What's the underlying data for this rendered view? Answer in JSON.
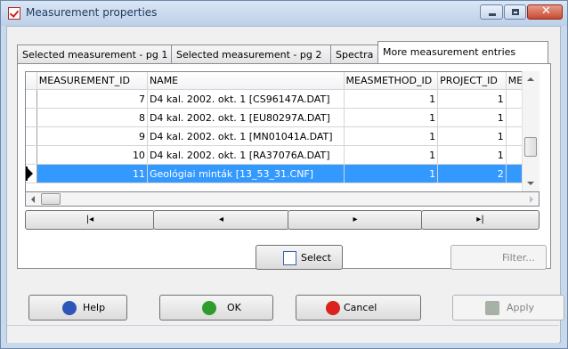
{
  "window": {
    "title": "Measurement properties"
  },
  "tabs": [
    "Selected measurement - pg 1",
    "Selected measurement - pg 2",
    "Spectra",
    "More measurement entries"
  ],
  "table": {
    "columns": [
      "MEASUREMENT_ID",
      "NAME",
      "MEASMETHOD_ID",
      "PROJECT_ID",
      "ME/"
    ],
    "rows": [
      {
        "id": "7",
        "name": "D4 kal. 2002. okt. 1 [CS96147A.DAT]",
        "method": "1",
        "project": "1"
      },
      {
        "id": "8",
        "name": "D4 kal. 2002. okt. 1 [EU80297A.DAT]",
        "method": "1",
        "project": "1"
      },
      {
        "id": "9",
        "name": "D4 kal. 2002. okt. 1 [MN01041A.DAT]",
        "method": "1",
        "project": "1"
      },
      {
        "id": "10",
        "name": "D4 kal. 2002. okt. 1 [RA37076A.DAT]",
        "method": "1",
        "project": "1"
      },
      {
        "id": "11",
        "name": "Geológiai minták [13_53_31.CNF]",
        "method": "1",
        "project": "2"
      }
    ],
    "selected_row": "11"
  },
  "navigator": {
    "first": "|◂",
    "prev": "◂",
    "next": "▸",
    "last": "▸|"
  },
  "buttons": {
    "select": "Select",
    "filter": "Filter...",
    "help": "Help",
    "ok": "OK",
    "cancel": "Cancel",
    "apply": "Apply"
  },
  "icons": {
    "app": "checkbox-document-icon",
    "select": "checkbox-document-icon",
    "help": "question-icon",
    "ok": "check-circle-icon",
    "cancel": "x-circle-icon",
    "apply": "apply-hand-icon"
  },
  "colors": {
    "selection": "#3399ff",
    "title_text": "#1e395b",
    "close_button": "#c74a30"
  }
}
